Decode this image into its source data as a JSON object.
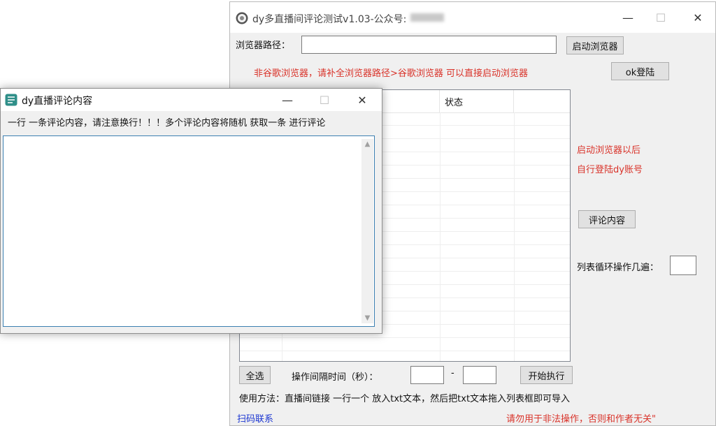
{
  "main_window": {
    "title": "dy多直播间评论测试v1.03-公众号:",
    "browser_path_label": "浏览器路径：",
    "browser_path_value": "",
    "launch_browser_button": "启动浏览器",
    "ok_login_button": "ok登陆",
    "notice_red": "非谷歌浏览器，请补全浏览器路径>谷歌浏览器 可以直接启动浏览器",
    "list": {
      "columns": [
        "",
        "",
        "状态",
        ""
      ],
      "rows": []
    },
    "hint_line1": "启动浏览器以后",
    "hint_line2": "自行登陆dy账号",
    "comment_content_button": "评论内容",
    "loop_label": "列表循环操作几遍：",
    "loop_value": "",
    "select_all_button": "全选",
    "interval_label": "操作间隔时间（秒）：",
    "interval_min": "",
    "interval_separator": "-",
    "interval_max": "",
    "start_button": "开始执行",
    "usage_text": "使用方法：直播间链接 一行一个 放入txt文本，然后把txt文本拖入列表框即可导入",
    "scan_contact": "扫码联系",
    "warning_text": "请勿用于非法操作，否则和作者无关\""
  },
  "comment_window": {
    "title": "dy直播评论内容",
    "instruction": "一行 一条评论内容，请注意换行！！！多个评论内容将随机 获取一条 进行评论",
    "content": ""
  },
  "icons": {
    "minimize": "minimize-icon",
    "maximize": "maximize-icon",
    "close": "close-icon"
  },
  "colors": {
    "red_text": "#d9332a",
    "blue_text": "#1c36d1",
    "window_bg": "#f0f0f0"
  }
}
